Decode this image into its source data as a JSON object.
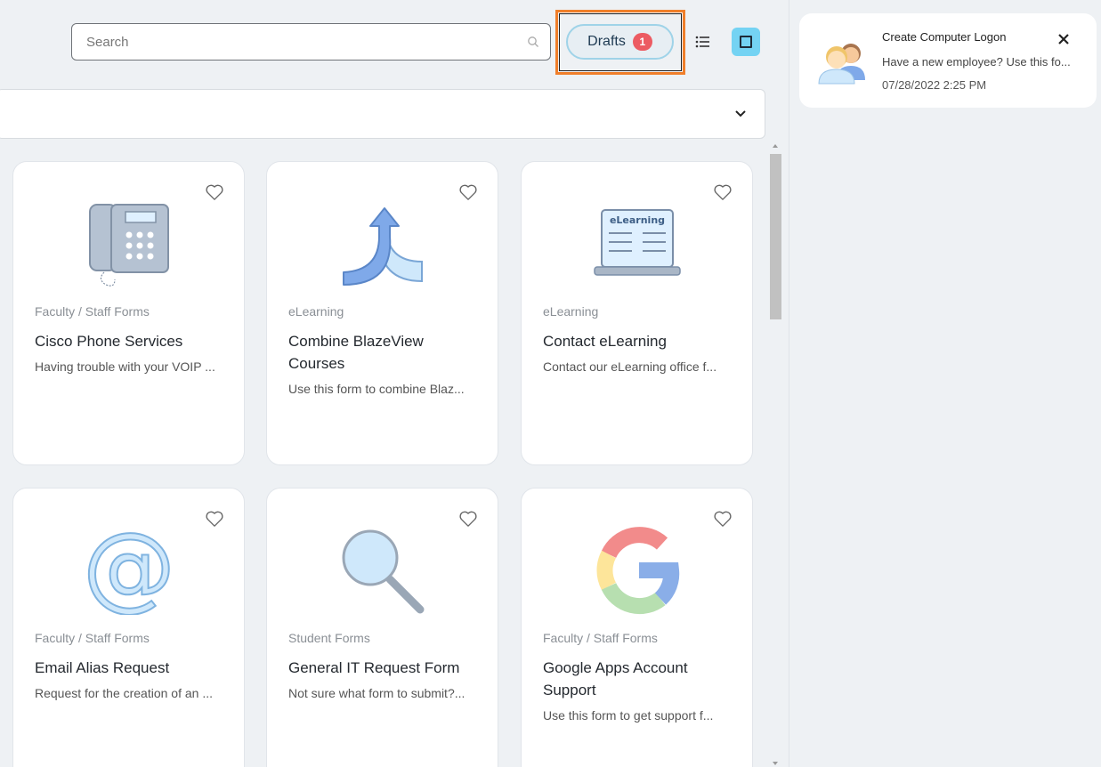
{
  "toolbar": {
    "search_placeholder": "Search",
    "search_value": "",
    "drafts_label": "Drafts",
    "drafts_count": "1",
    "grid_view_active_color": "#74d3f3",
    "highlight_color": "#f07f2a"
  },
  "filter": {
    "icon": "chevron-down-icon"
  },
  "cards": [
    {
      "category": "Faculty / Staff Forms",
      "title": "Cisco Phone Services",
      "description": "Having trouble with your VOIP ...",
      "icon": "desk-phone-icon"
    },
    {
      "category": "eLearning",
      "title": "Combine BlazeView Courses",
      "description": "Use this form to combine Blaz...",
      "icon": "merge-arrows-icon"
    },
    {
      "category": "eLearning",
      "title": "Contact eLearning",
      "description": "Contact our eLearning office f...",
      "icon": "laptop-elearning-icon",
      "icon_text": "eLearning"
    },
    {
      "category": "Faculty / Staff Forms",
      "title": "Email Alias Request",
      "description": "Request for the creation of an ...",
      "icon": "at-sign-icon"
    },
    {
      "category": "Student Forms",
      "title": "General IT Request Form",
      "description": "Not sure what form to submit?...",
      "icon": "magnifier-icon"
    },
    {
      "category": "Faculty / Staff Forms",
      "title": "Google Apps Account Support",
      "description": "Use this form to get support f...",
      "icon": "google-g-icon"
    }
  ],
  "notification": {
    "title": "Create Computer Logon",
    "message": "Have a new employee? Use this fo...",
    "timestamp": "07/28/2022 2:25 PM",
    "icon": "users-avatar-icon"
  }
}
